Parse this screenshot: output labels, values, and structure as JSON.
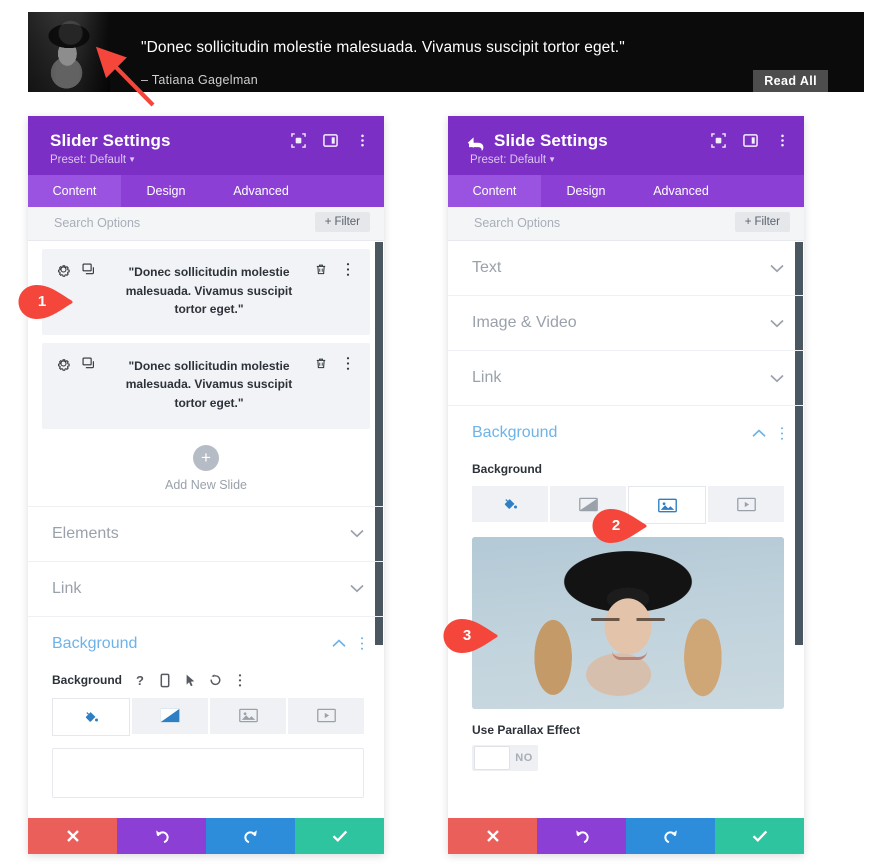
{
  "slider_preview": {
    "quote": "\"Donec sollicitudin molestie malesuada. Vivamus suscipit tortor eget.\"",
    "author": "– Tatiana Gagelman",
    "button_label": "Read All",
    "avatar_alt": "portrait-photo",
    "background_color": "#0b0b0b",
    "button_color": "#4d4d4d"
  },
  "annotations": {
    "arrow": "red-arrow-pointing-to-avatar",
    "badge1": "1",
    "badge2": "2",
    "badge3": "3",
    "badge_color": "#f4463a"
  },
  "left_panel": {
    "title": "Slider Settings",
    "preset": "Preset: Default",
    "header_color": "#7b2fc4",
    "header_icons": [
      "focus-icon",
      "layout-icon",
      "kebab-menu-icon"
    ],
    "tabs": [
      {
        "label": "Content",
        "active": true
      },
      {
        "label": "Design",
        "active": false
      },
      {
        "label": "Advanced",
        "active": false
      }
    ],
    "search": {
      "placeholder": "Search Options",
      "value": ""
    },
    "filter_label": "Filter",
    "slides": [
      {
        "text": "\"Donec sollicitudin molestie malesuada. Vivamus suscipit tortor eget.\""
      },
      {
        "text": "\"Donec sollicitudin molestie malesuada. Vivamus suscipit tortor eget.\""
      }
    ],
    "add_slide_label": "Add New Slide",
    "add_slide_plus": "+",
    "sections": [
      {
        "label": "Elements",
        "open": false
      },
      {
        "label": "Link",
        "open": false
      },
      {
        "label": "Background",
        "open": true
      }
    ],
    "background": {
      "field_label": "Background",
      "meta_icons": [
        "help-icon",
        "responsive-icon",
        "hover-icon",
        "reset-icon",
        "kebab-menu-icon"
      ],
      "tabs": [
        {
          "icon": "paint-bucket-icon",
          "active": true
        },
        {
          "icon": "gradient-icon",
          "active": false
        },
        {
          "icon": "image-icon",
          "active": false
        },
        {
          "icon": "video-icon",
          "active": false
        }
      ]
    },
    "actions": [
      {
        "icon": "close-icon",
        "color": "#eb5f5a"
      },
      {
        "icon": "undo-icon",
        "color": "#8b3fd4"
      },
      {
        "icon": "redo-icon",
        "color": "#2d8ddb"
      },
      {
        "icon": "check-icon",
        "color": "#2ec4a0"
      }
    ]
  },
  "right_panel": {
    "title": "Slide Settings",
    "preset": "Preset: Default",
    "header_color": "#7b2fc4",
    "back_icon": "back-arrow-icon",
    "header_icons": [
      "focus-icon",
      "layout-icon",
      "kebab-menu-icon"
    ],
    "tabs": [
      {
        "label": "Content",
        "active": true
      },
      {
        "label": "Design",
        "active": false
      },
      {
        "label": "Advanced",
        "active": false
      }
    ],
    "search": {
      "placeholder": "Search Options",
      "value": ""
    },
    "filter_label": "Filter",
    "sections": [
      {
        "label": "Text",
        "open": false
      },
      {
        "label": "Image & Video",
        "open": false
      },
      {
        "label": "Link",
        "open": false
      },
      {
        "label": "Background",
        "open": true
      }
    ],
    "background": {
      "field_label": "Background",
      "tabs": [
        {
          "icon": "paint-bucket-icon",
          "active": false
        },
        {
          "icon": "gradient-icon",
          "active": false
        },
        {
          "icon": "image-icon",
          "active": true
        },
        {
          "icon": "video-icon",
          "active": false
        }
      ],
      "image_alt": "woman-with-black-hat-portrait"
    },
    "parallax": {
      "label": "Use Parallax Effect",
      "value": "NO"
    },
    "actions": [
      {
        "icon": "close-icon",
        "color": "#eb5f5a"
      },
      {
        "icon": "undo-icon",
        "color": "#8b3fd4"
      },
      {
        "icon": "redo-icon",
        "color": "#2d8ddb"
      },
      {
        "icon": "check-icon",
        "color": "#2ec4a0"
      }
    ]
  }
}
